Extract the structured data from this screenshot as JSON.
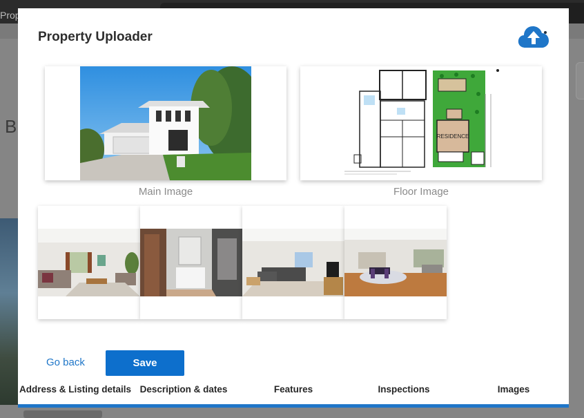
{
  "background": {
    "tab_label": "Prop",
    "heading_letter": "B"
  },
  "modal": {
    "title": "Property Uploader",
    "upload_icon": "cloud-upload-icon",
    "main_image_caption": "Main Image",
    "floor_image_caption": "Floor Image",
    "floorplan_room_label": "RESIDENCE",
    "gallery": [
      {
        "name": "living-room-photo"
      },
      {
        "name": "bathroom-photo"
      },
      {
        "name": "lounge-photo"
      },
      {
        "name": "dining-photo"
      }
    ],
    "go_back_label": "Go back",
    "save_label": "Save"
  },
  "tabs": [
    {
      "label": "Address & Listing details"
    },
    {
      "label": "Description & dates"
    },
    {
      "label": "Features"
    },
    {
      "label": "Inspections"
    },
    {
      "label": "Images"
    }
  ],
  "colors": {
    "accent": "#1f76c8",
    "save_button": "#0d6fcc",
    "tab_underline": "#1f76c8"
  }
}
